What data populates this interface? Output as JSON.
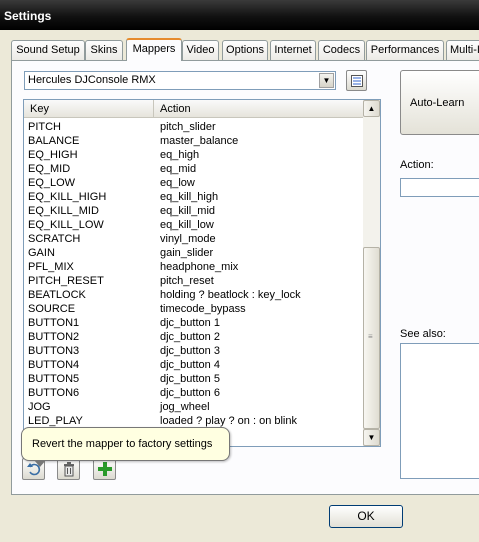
{
  "window": {
    "title": "Settings"
  },
  "tabs": [
    {
      "label": "Sound Setup"
    },
    {
      "label": "Skins"
    },
    {
      "label": "Mappers"
    },
    {
      "label": "Video"
    },
    {
      "label": "Options"
    },
    {
      "label": "Internet"
    },
    {
      "label": "Codecs"
    },
    {
      "label": "Performances"
    },
    {
      "label": "Multi-In"
    }
  ],
  "active_tab": "Mappers",
  "device": {
    "selected": "Hercules DJConsole RMX"
  },
  "list": {
    "headers": {
      "key": "Key",
      "action": "Action"
    },
    "rows": [
      {
        "key": "PITCH",
        "action": "pitch_slider"
      },
      {
        "key": "BALANCE",
        "action": "master_balance"
      },
      {
        "key": "EQ_HIGH",
        "action": "eq_high"
      },
      {
        "key": "EQ_MID",
        "action": "eq_mid"
      },
      {
        "key": "EQ_LOW",
        "action": "eq_low"
      },
      {
        "key": "EQ_KILL_HIGH",
        "action": "eq_kill_high"
      },
      {
        "key": "EQ_KILL_MID",
        "action": "eq_kill_mid"
      },
      {
        "key": "EQ_KILL_LOW",
        "action": "eq_kill_low"
      },
      {
        "key": "SCRATCH",
        "action": "vinyl_mode"
      },
      {
        "key": "GAIN",
        "action": "gain_slider"
      },
      {
        "key": "PFL_MIX",
        "action": "headphone_mix"
      },
      {
        "key": "PITCH_RESET",
        "action": "pitch_reset"
      },
      {
        "key": "BEATLOCK",
        "action": "holding ? beatlock : key_lock"
      },
      {
        "key": "SOURCE",
        "action": "timecode_bypass"
      },
      {
        "key": "BUTTON1",
        "action": "djc_button 1"
      },
      {
        "key": "BUTTON2",
        "action": "djc_button 2"
      },
      {
        "key": "BUTTON3",
        "action": "djc_button 3"
      },
      {
        "key": "BUTTON4",
        "action": "djc_button 4"
      },
      {
        "key": "BUTTON5",
        "action": "djc_button 5"
      },
      {
        "key": "BUTTON6",
        "action": "djc_button 6"
      },
      {
        "key": "JOG",
        "action": "jog_wheel"
      },
      {
        "key": "LED_PLAY",
        "action": "loaded ? play ? on : on blink"
      }
    ]
  },
  "tooltip": {
    "text": "Revert the mapper to factory settings"
  },
  "side": {
    "autolearn_label": "Auto-Learn",
    "action_label": "Action:",
    "action_value": "",
    "seealso_label": "See also:"
  },
  "footer": {
    "ok_label": "OK"
  },
  "colors": {
    "active_tab_accent": "#e68b2c",
    "tooltip_bg": "#ffffe1",
    "add_icon": "#2a9a2a"
  }
}
